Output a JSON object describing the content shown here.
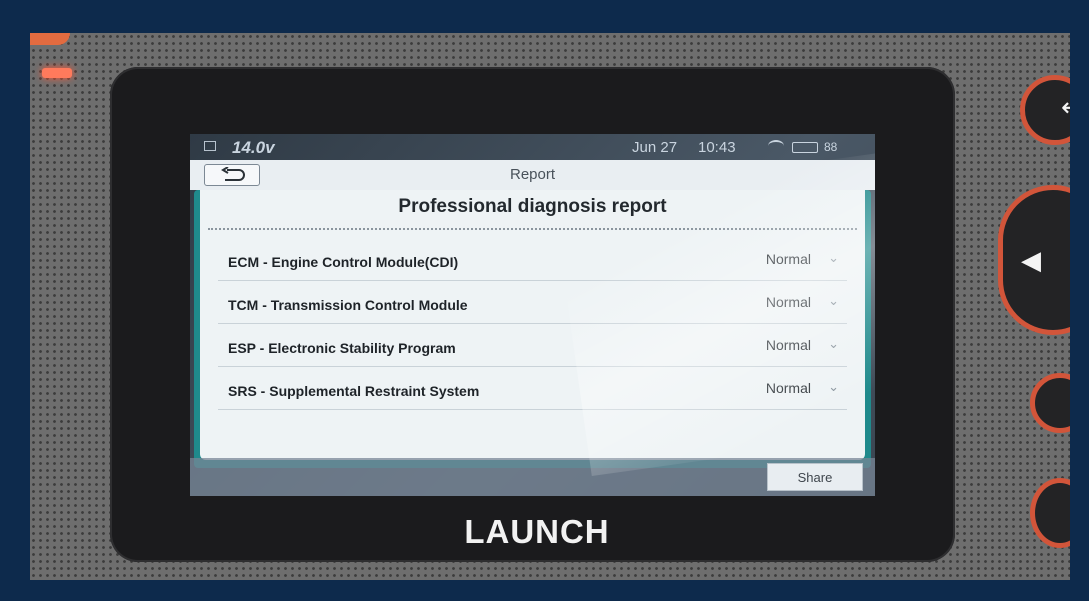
{
  "device": {
    "brand": "LAUNCH"
  },
  "status_bar": {
    "voltage": "14.0v",
    "date": "Jun 27",
    "time": "10:43",
    "battery": "88"
  },
  "titlebar": {
    "title": "Report",
    "back_icon": "back-arrow-icon"
  },
  "report": {
    "heading": "Professional diagnosis report",
    "rows": [
      {
        "name": "ECM - Engine Control Module(CDI)",
        "status": "Normal"
      },
      {
        "name": "TCM - Transmission Control Module",
        "status": "Normal"
      },
      {
        "name": "ESP - Electronic Stability Program",
        "status": "Normal"
      },
      {
        "name": "SRS - Supplemental Restraint System",
        "status": "Normal"
      }
    ]
  },
  "footer": {
    "share_label": "Share"
  },
  "colors": {
    "teal_frame": "#1f8a8c",
    "button_ring": "#d2553a"
  }
}
